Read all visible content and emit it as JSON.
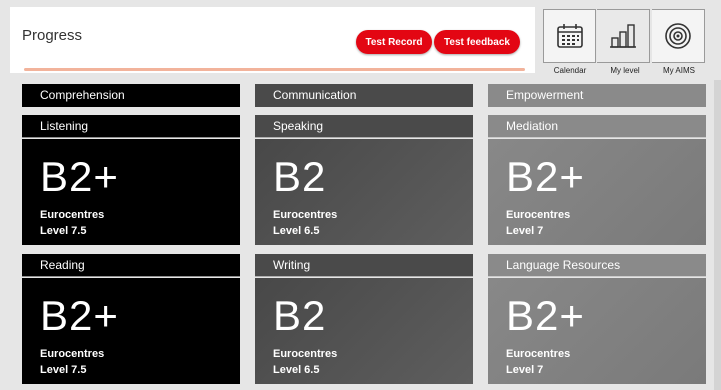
{
  "header": {
    "title": "Progress",
    "buttons": {
      "test_record": "Test Record",
      "test_feedback": "Test feedback"
    }
  },
  "nav": [
    {
      "label": "Calendar",
      "icon": "calendar-icon"
    },
    {
      "label": "My level",
      "icon": "bar-chart-icon"
    },
    {
      "label": "My AIMS",
      "icon": "target-icon"
    }
  ],
  "columns": [
    {
      "category": "Comprehension",
      "skills": [
        {
          "name": "Listening",
          "level": "B2+",
          "institution": "Eurocentres",
          "detail": "Level 7.5"
        },
        {
          "name": "Reading",
          "level": "B2+",
          "institution": "Eurocentres",
          "detail": "Level 7.5"
        }
      ]
    },
    {
      "category": "Communication",
      "skills": [
        {
          "name": "Speaking",
          "level": "B2",
          "institution": "Eurocentres",
          "detail": "Level 6.5"
        },
        {
          "name": "Writing",
          "level": "B2",
          "institution": "Eurocentres",
          "detail": "Level 6.5"
        }
      ]
    },
    {
      "category": "Empowerment",
      "skills": [
        {
          "name": "Mediation",
          "level": "B2+",
          "institution": "Eurocentres",
          "detail": "Level 7"
        },
        {
          "name": "Language Resources",
          "level": "B2+",
          "institution": "Eurocentres",
          "detail": "Level 7"
        }
      ]
    }
  ],
  "colors": {
    "accent": "#e30613",
    "comprehension": "#000000",
    "communication": "#4a4a4a",
    "empowerment": "#8a8a8a"
  }
}
